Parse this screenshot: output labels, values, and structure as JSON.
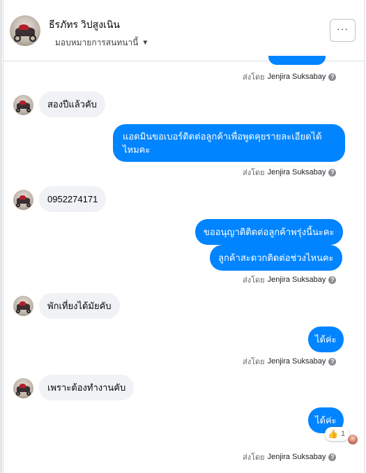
{
  "header": {
    "contact_name": "ธีรภัทร วิปสูงเนิน",
    "assign_label": "มอบหมายการสนทนานี้",
    "more_label": "···"
  },
  "sent_by_prefix": "ส่งโดย",
  "sender_name": "Jenjira Suksabay",
  "messages": {
    "m1": "สองปีแล้วคับ",
    "m2_line1": "แอดมินขอเบอร์ติดต่อลูกค้าเพื่อพูดคุยรายละเอียดได้",
    "m2_line2": "ไหมคะ",
    "m3": "0952274171",
    "m4": "ขออนุญาติติดต่อลูกค้าพรุ่งนี้นะคะ",
    "m5": "ลูกค้าสะดวกติดต่อช่วงไหนคะ",
    "m6": "พักเที่ยงได้มัยคับ",
    "m7": "ได้ค่ะ",
    "m8": "เพราะต้องทำงานคับ",
    "m9": "ได้ค่ะ"
  },
  "reaction": {
    "icon": "thumbs-up-icon",
    "count": "1"
  },
  "colors": {
    "outgoing": "#0084ff",
    "incoming": "#f0f2f5"
  }
}
